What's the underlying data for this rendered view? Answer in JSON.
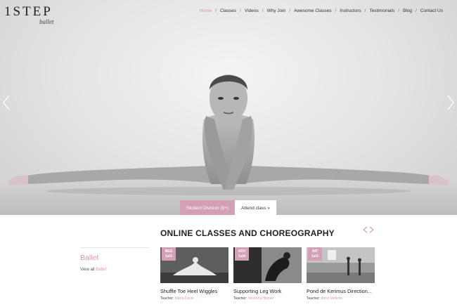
{
  "brand": {
    "name": "1STEP",
    "tagline": "ballet"
  },
  "nav": {
    "items": [
      {
        "label": "Home"
      },
      {
        "label": "Classes"
      },
      {
        "label": "Videos"
      },
      {
        "label": "Why Join"
      },
      {
        "label": "Awesome Classes"
      },
      {
        "label": "Instructors"
      },
      {
        "label": "Testimonials"
      },
      {
        "label": "Blog"
      },
      {
        "label": "Contact Us"
      }
    ],
    "separator": "/"
  },
  "hero": {
    "prev_icon": "chevron-left-icon",
    "next_icon": "chevron-right-icon",
    "primary_cta": "Student Division (8+)",
    "secondary_cta": "Attend class »"
  },
  "section": {
    "title_bold": "ONLINE",
    "title_rest": " CLASSES AND CHOREOGRAPHY",
    "arrows_icon": "chevron-pair-icon"
  },
  "category": {
    "title": "Ballet",
    "view_all_prefix": "View all ",
    "view_all_link": "Ballet"
  },
  "cards": [
    {
      "badge_level": "BEG",
      "badge_code": "1st1",
      "title": "Shuffle Toe Heel Wiggles",
      "teacher_label": "Teacher:",
      "teacher_name": "Marta Davis"
    },
    {
      "badge_level": "ADV",
      "badge_code": "1st4",
      "title": "Supporting Leg Work",
      "teacher_label": "Teacher:",
      "teacher_name": "Veronica Hianek"
    },
    {
      "badge_level": "INT",
      "badge_code": "1st1",
      "title": "Pond de Kerimus Direction...",
      "teacher_label": "Teacher:",
      "teacher_name": "Anna Verikine"
    }
  ],
  "colors": {
    "accent": "#d3a0b6",
    "accent_text": "#d895b2"
  }
}
